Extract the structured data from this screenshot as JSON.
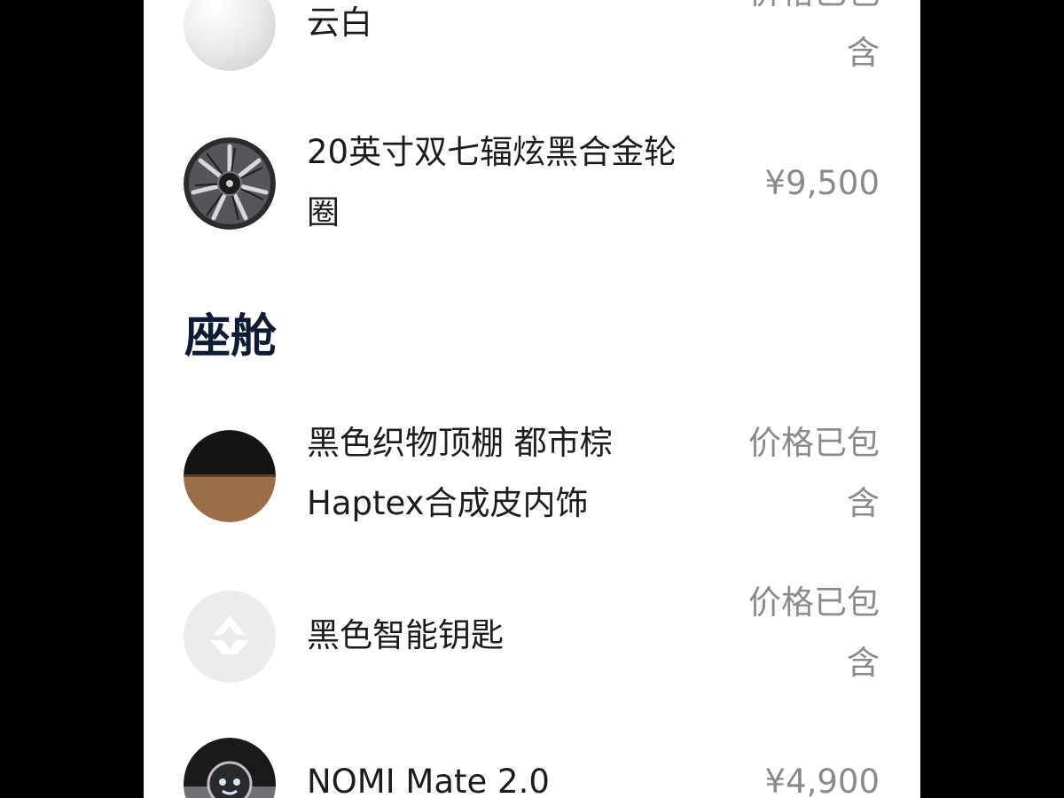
{
  "items_top": [
    {
      "name": "云白",
      "price": "价格已包含"
    },
    {
      "name": "20英寸双七辐炫黑合金轮圈",
      "price": "¥9,500"
    }
  ],
  "section": {
    "title": "座舱"
  },
  "items_cabin": [
    {
      "name": "黑色织物顶棚 都市棕Haptex合成皮内饰",
      "price": "价格已包含"
    },
    {
      "name": "黑色智能钥匙",
      "price": "价格已包含"
    },
    {
      "name": "NOMI Mate 2.0",
      "price": "¥4,900"
    }
  ],
  "icons": {
    "cloud_white": "white-paint-swatch-icon",
    "wheel": "alloy-wheel-icon",
    "interior": "interior-trim-swatch-icon",
    "key": "nio-logo-key-icon",
    "nomi": "nomi-robot-icon"
  },
  "colors": {
    "panel_bg": "#ffffff",
    "outer_bg": "#000000",
    "text_primary": "#1c1c1e",
    "text_price": "#8a8a8e",
    "section_title": "#0f1a33",
    "interior_top": "#151515",
    "interior_bottom": "#9a6e48"
  }
}
